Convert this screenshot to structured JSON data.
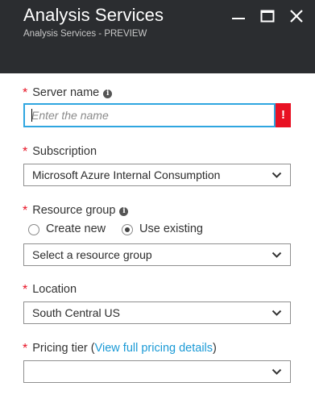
{
  "header": {
    "title": "Analysis Services",
    "subtitle": "Analysis Services - PREVIEW"
  },
  "window_controls": [
    "minimize-icon",
    "maximize-icon",
    "close-icon"
  ],
  "form": {
    "server_name": {
      "required_mark": "*",
      "label": "Server name",
      "info_icon": "i",
      "placeholder": "Enter the name",
      "value": "",
      "error_badge": "!"
    },
    "subscription": {
      "required_mark": "*",
      "label": "Subscription",
      "selected": "Microsoft Azure Internal Consumption"
    },
    "resource_group": {
      "required_mark": "*",
      "label": "Resource group",
      "info_icon": "i",
      "options": [
        {
          "label": "Create new",
          "selected": false
        },
        {
          "label": "Use existing",
          "selected": true
        }
      ],
      "selected": "Select a resource group"
    },
    "location": {
      "required_mark": "*",
      "label": "Location",
      "selected": "South Central US"
    },
    "pricing_tier": {
      "required_mark": "*",
      "label": "Pricing tier",
      "open_paren": "(",
      "link_text": "View full pricing details",
      "close_paren": ")",
      "selected": ""
    }
  },
  "colors": {
    "header_bg": "#2b2d30",
    "required": "#e81123",
    "focus_border": "#2fa6e0",
    "error": "#e81123",
    "link": "#1a9ad6"
  }
}
